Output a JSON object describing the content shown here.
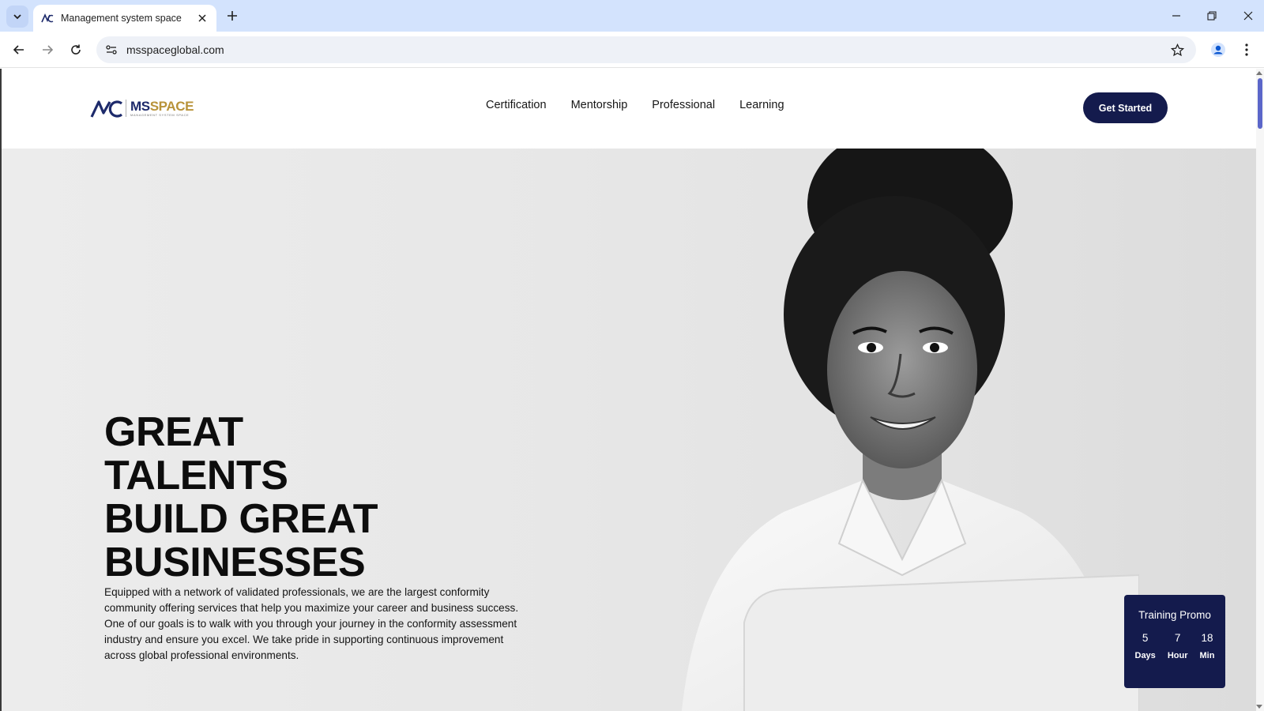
{
  "browser": {
    "tab_title": "Management system space",
    "url": "msspaceglobal.com"
  },
  "site": {
    "logo": {
      "ms": "MS",
      "space": "SPACE",
      "tagline": "Management system space"
    },
    "nav": [
      "Certification",
      "Mentorship",
      "Professional",
      "Learning"
    ],
    "cta_label": "Get Started"
  },
  "hero": {
    "title_lines": [
      "GREAT",
      "TALENTS",
      "BUILD GREAT",
      "BUSINESSES"
    ],
    "description": "Equipped with a network of validated professionals, we are the largest conformity community offering services that help you maximize your career and business success. One of our goals is to walk with you through your journey in the conformity assessment industry and ensure you excel. We take pride in supporting continuous improvement across global professional environments."
  },
  "promo": {
    "title": "Training Promo",
    "countdown": [
      {
        "value": "5",
        "label": "Days"
      },
      {
        "value": "7",
        "label": "Hour"
      },
      {
        "value": "18",
        "label": "Min"
      }
    ]
  },
  "colors": {
    "brand_navy": "#141b4d",
    "brand_gold": "#b8933a",
    "tabstrip": "#d3e3fd"
  }
}
